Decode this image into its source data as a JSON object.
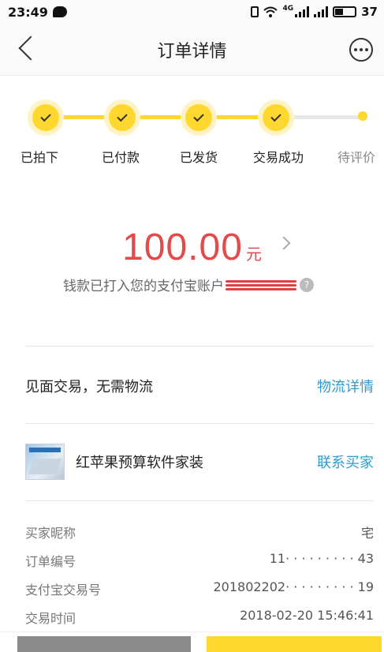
{
  "status_bar": {
    "time": "23:49",
    "network_label": "4G",
    "battery": "37"
  },
  "header": {
    "title": "订单详情"
  },
  "progress": {
    "steps": [
      "已拍下",
      "已付款",
      "已发货",
      "交易成功",
      "待评价"
    ],
    "completed": 4,
    "colors": {
      "active": "#ffd72f",
      "inactive": "#e8e8e8",
      "pending_text": "#888888"
    }
  },
  "amount": {
    "value": "100.00",
    "unit": "元",
    "note": "钱款已打入您的支付宝账户",
    "color": "#e24b4b"
  },
  "shipping": {
    "text": "见面交易，无需物流",
    "link": "物流详情"
  },
  "product": {
    "name": "红苹果预算软件家装",
    "link": "联系买家"
  },
  "details": [
    {
      "label": "买家昵称",
      "value": "宅"
    },
    {
      "label": "订单编号",
      "value": "11· · · · · · · · · 43"
    },
    {
      "label": "支付宝交易号",
      "value": "201802202· · · · · · · · · 19"
    },
    {
      "label": "交易时间",
      "value": "2018-02-20 15:46:41"
    }
  ]
}
